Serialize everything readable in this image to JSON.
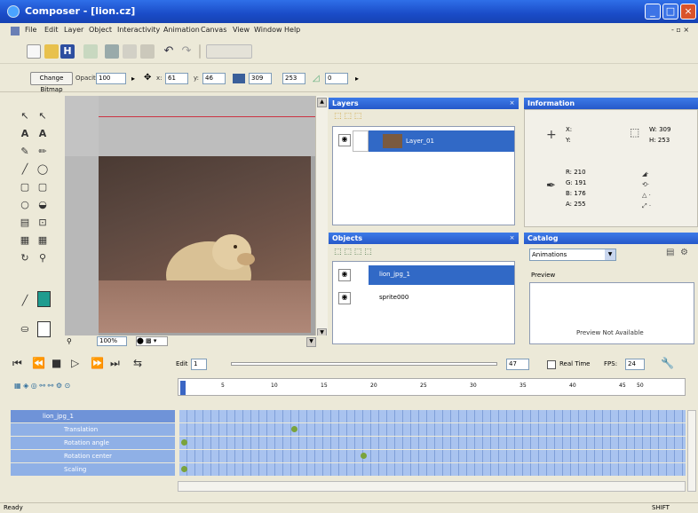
{
  "window": {
    "title": "Composer - [lion.cz]",
    "controls": [
      "_",
      "□",
      "×"
    ]
  },
  "menu": [
    "File",
    "Edit",
    "Layer",
    "Object",
    "Interactivity",
    "Animation",
    "Canvas",
    "View",
    "Window",
    "Help"
  ],
  "toolbar2": {
    "change_bitmap": "Change Bitmap",
    "opacity_label": "Opacity:",
    "opacity_value": "100",
    "x_label": "x:",
    "x_value": "61",
    "y_label": "y:",
    "y_value": "46",
    "w_value": "309",
    "h_value": "253",
    "angle_value": "0"
  },
  "canvas": {
    "zoom": "100%"
  },
  "layers_panel": {
    "title": "Layers",
    "items": [
      {
        "label": "Layer_01"
      }
    ]
  },
  "objects_panel": {
    "title": "Objects",
    "items": [
      {
        "label": "lion_jpg_1",
        "selected": true
      },
      {
        "label": "sprite000"
      }
    ]
  },
  "info_panel": {
    "title": "Information",
    "x": "X:",
    "y": "Y:",
    "w": "W: 309",
    "h": "H: 253",
    "r": "R: 210",
    "g": "G: 191",
    "b": "B: 176",
    "a": "A: 255"
  },
  "catalog_panel": {
    "title": "Catalog",
    "dropdown": "Animations",
    "preview_label": "Preview",
    "preview_text": "Preview Not Available"
  },
  "timeline": {
    "edit_label": "Edit",
    "edit_value": "1",
    "frame_value": "47",
    "realtime_label": "Real Time",
    "fps_label": "FPS:",
    "fps_value": "24",
    "ruler_ticks": [
      "0",
      "5",
      "10",
      "15",
      "20",
      "25",
      "30",
      "35",
      "40",
      "45",
      "50"
    ],
    "rows": [
      {
        "label": "lion_jpg_1",
        "type": "object"
      },
      {
        "label": "Translation",
        "type": "track"
      },
      {
        "label": "Rotation angle",
        "type": "track"
      },
      {
        "label": "Rotation center",
        "type": "track"
      },
      {
        "label": "Scaling",
        "type": "track"
      }
    ]
  },
  "status": {
    "left": "Ready",
    "right": "SHIFT"
  },
  "colors": {
    "title_blue": "#1a4cc8",
    "panel_blue": "#2658c9",
    "selection": "#3169c6",
    "fill_swatch": "#1f9c8f",
    "keyframe": "#7aa33b"
  }
}
